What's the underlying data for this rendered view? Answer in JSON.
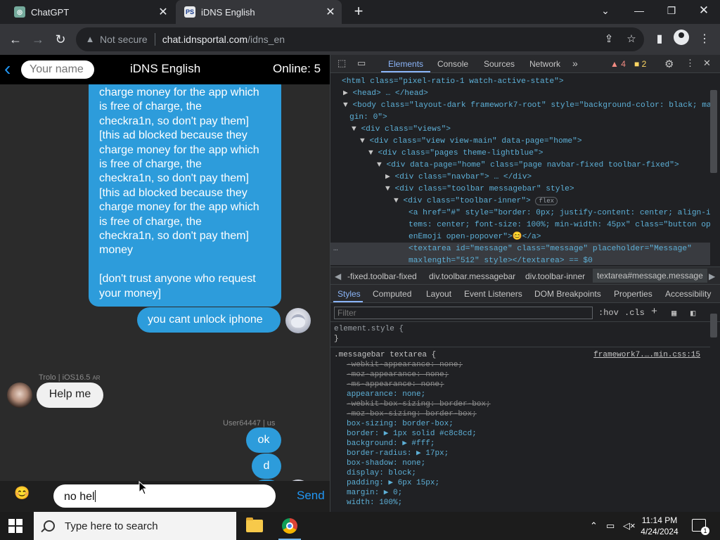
{
  "browser": {
    "tabs": [
      {
        "title": "ChatGPT",
        "favicon": "chatgpt-favicon"
      },
      {
        "title": "iDNS English",
        "favicon": "idns-favicon",
        "active": true
      }
    ],
    "address": {
      "security": "Not secure",
      "host": "chat.idnsportal.com",
      "path": "/idns_en"
    }
  },
  "chat": {
    "name_placeholder": "Your name",
    "title": "iDNS English",
    "online": "Online: 5",
    "long_message": "charge money for the app which\nis free of charge, the\ncheckra1n, so don't pay them]\n[this ad blocked because they\ncharge money for the app which\nis free of charge, the\ncheckra1n, so don't pay them]\n[this ad blocked because they\ncharge money for the app which\nis free of charge, the\ncheckra1n, so don't pay them]\nmoney\n\n[don't trust anyone who request\nyour money]",
    "msg_unlock": "you cant unlock iphone",
    "sender_trolo": "Trolo | iOS16.5",
    "sender_trolo_flag": "AR",
    "msg_help": "Help me",
    "sender_user": "User64447 | us",
    "msg_ok": "ok",
    "msg_d1": "d",
    "msg_d2": "d",
    "input_value": "no hel",
    "send_label": "Send"
  },
  "devtools": {
    "tabs": [
      "Elements",
      "Console",
      "Sources",
      "Network"
    ],
    "warnings": "4",
    "errors": "2",
    "crumbs": [
      "-fixed.toolbar-fixed",
      "div.toolbar.messagebar",
      "div.toolbar-inner",
      "textarea#message.message"
    ],
    "subtabs": [
      "Styles",
      "Computed",
      "Layout",
      "Event Listeners",
      "DOM Breakpoints",
      "Properties",
      "Accessibility"
    ],
    "filter_placeholder": "Filter",
    "hov": ":hov",
    "cls": ".cls",
    "flex_badge": "flex",
    "source_link": "framework7.….min.css:15",
    "dom_lines": {
      "l1": "<html class=\"pixel-ratio-1 watch-active-state\">",
      "l2": "<head> … </head>",
      "l3a": "<body class=\"layout-dark framework7-root\" style=\"background-color: black; mar",
      "l3b": "gin: 0\">",
      "l4": "<div class=\"views\">",
      "l5": "<div class=\"view view-main\" data-page=\"home\">",
      "l6": "<div class=\"pages theme-lightblue\">",
      "l7": "<div data-page=\"home\" class=\"page navbar-fixed toolbar-fixed\">",
      "l8": "<div class=\"navbar\"> … </div>",
      "l9": "<div class=\"toolbar messagebar\" style>",
      "l10": "<div class=\"toolbar-inner\">",
      "l11a": "<a href=\"#\" style=\"border: 0px; justify-content: center; align-i",
      "l11b": "tems: center; font-size: 100%; min-width: 45px\" class=\"button op",
      "l11c": "enEmoji open-popover\">😊</a>",
      "l12a": "<textarea id=\"message\" class=\"message\" placeholder=\"Message\"",
      "l12b": "maxlength=\"512\" style></textarea> == $0"
    },
    "style_lines": {
      "s1": "element.style {",
      "s2": "}",
      "s3": ".messagebar textarea {",
      "s4": "-webkit-appearance: none;",
      "s5": "-moz-appearance: none;",
      "s6": "-ms-appearance: none;",
      "s7": "appearance: none;",
      "s8": "-webkit-box-sizing: border-box;",
      "s9": "-moz-box-sizing: border-box;",
      "s10": "box-sizing: border-box;",
      "s11": "border: ▶ 1px solid #c8c8cd;",
      "s12": "background: ▶ #fff;",
      "s13": "border-radius: ▶ 17px;",
      "s14": "box-shadow: none;",
      "s15": "display: block;",
      "s16": "padding: ▶ 6px 15px;",
      "s17": "margin: ▶ 0;",
      "s18": "width: 100%;"
    }
  },
  "taskbar": {
    "search_placeholder": "Type here to search",
    "time": "11:14 PM",
    "date": "4/24/2024",
    "notifications": "1"
  }
}
